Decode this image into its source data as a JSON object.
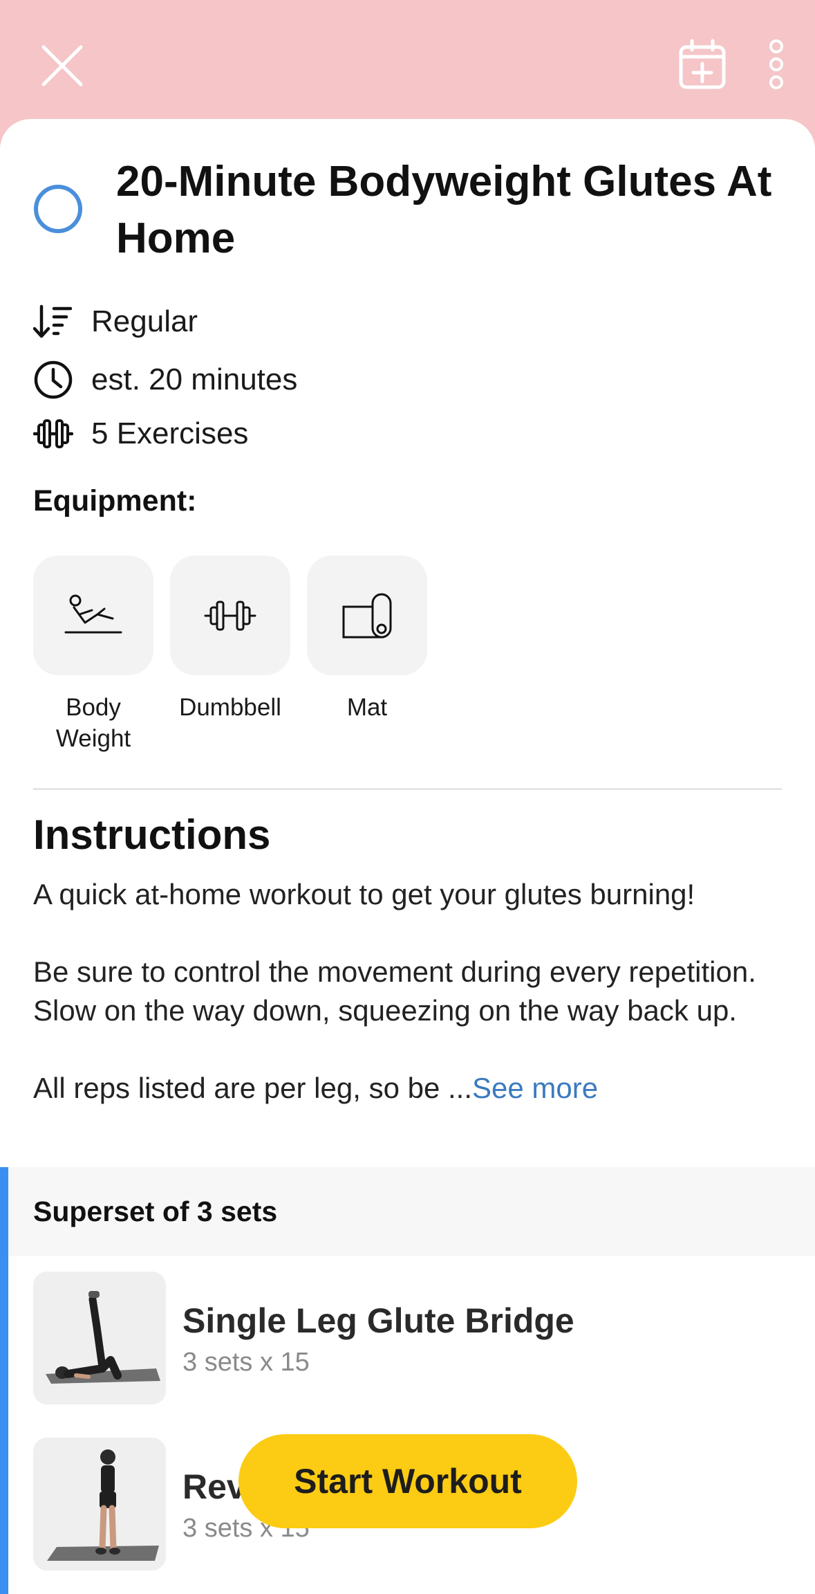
{
  "header": {
    "close_icon": "close-icon",
    "calendar_icon": "calendar-add-icon",
    "more_icon": "more-vertical-icon"
  },
  "workout": {
    "title": "20-Minute Bodyweight Glutes At Home",
    "level": "Regular",
    "duration": "est. 20 minutes",
    "exercise_count": "5 Exercises"
  },
  "equipment": {
    "label": "Equipment:",
    "items": [
      {
        "name": "Body Weight",
        "icon": "body-weight-icon"
      },
      {
        "name": "Dumbbell",
        "icon": "dumbbell-icon"
      },
      {
        "name": "Mat",
        "icon": "mat-icon"
      }
    ]
  },
  "instructions": {
    "title": "Instructions",
    "p1": "A quick at-home workout to get your glutes burning!",
    "p2": "Be sure to control the movement during every repetition. Slow on the way down, squeezing on the way back up.",
    "p3": "All reps listed are per leg, so be ...",
    "see_more": "See more"
  },
  "superset": {
    "label": "Superset of 3 sets",
    "exercises": [
      {
        "name": "Single Leg Glute Bridge",
        "sets": "3 sets x 15"
      },
      {
        "name": "Rev",
        "sets": "3 sets x 15"
      }
    ]
  },
  "cta": {
    "start_label": "Start Workout"
  },
  "colors": {
    "header_bg": "#f5c5c8",
    "accent_blue": "#3b8ff0",
    "cta_yellow": "#fccb13",
    "link_blue": "#3b7bbf"
  }
}
